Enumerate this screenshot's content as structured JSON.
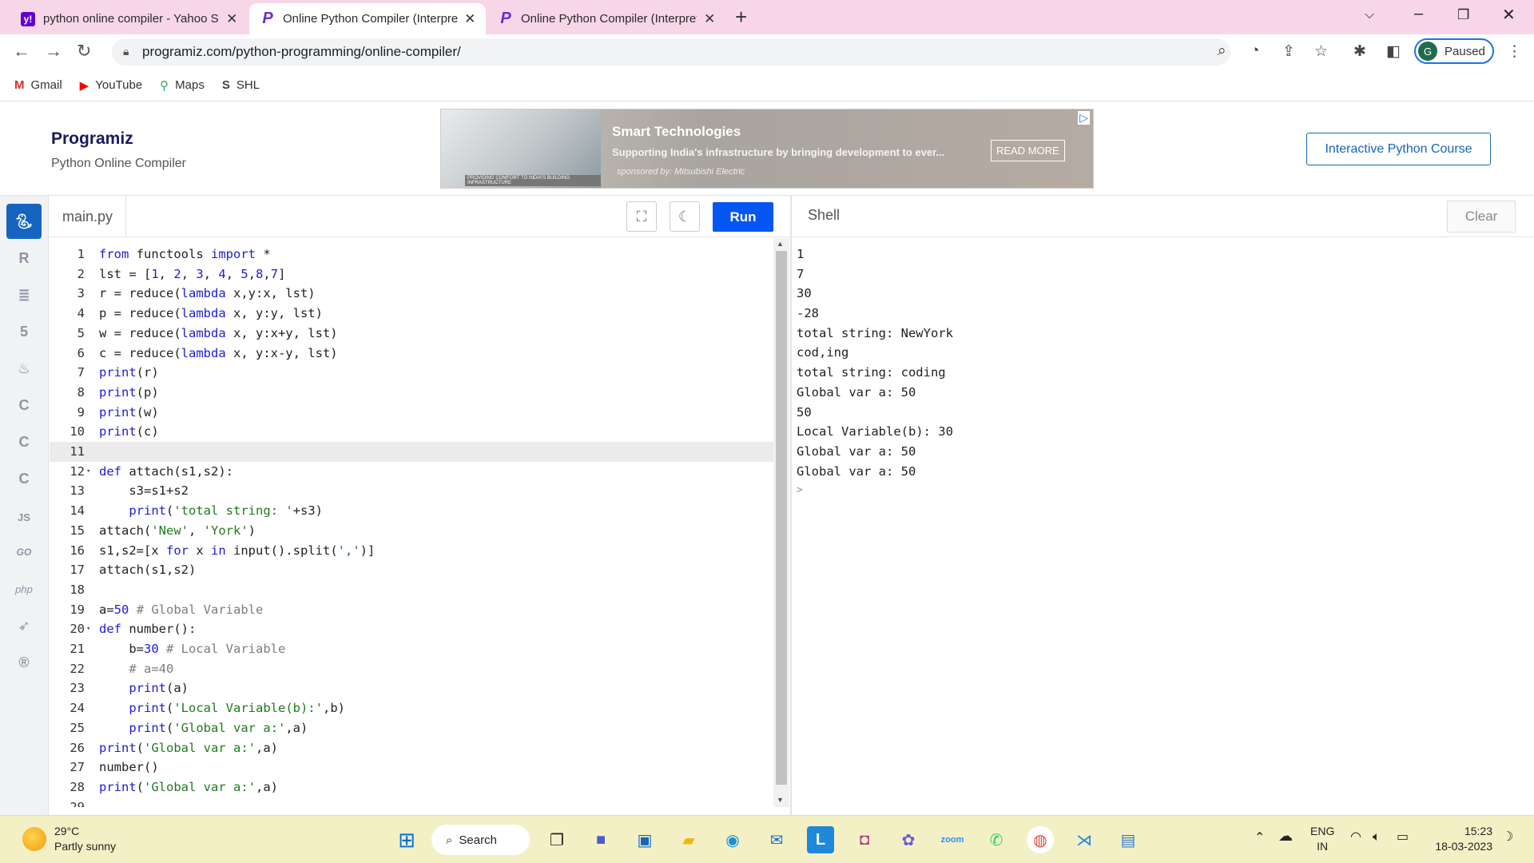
{
  "browser": {
    "tabs": [
      {
        "title": "python online compiler - Yahoo Search",
        "favicon": "yahoo-icon",
        "active": false
      },
      {
        "title": "Online Python Compiler (Interpreter)",
        "favicon": "programiz-icon",
        "active": true
      },
      {
        "title": "Online Python Compiler (Interpreter)",
        "favicon": "programiz-icon",
        "active": false
      }
    ],
    "url": "programiz.com/python-programming/online-compiler/",
    "profile_initial": "G",
    "profile_status": "Paused",
    "bookmarks": [
      {
        "label": "Gmail",
        "icon": "gmail-icon",
        "color": "#d93025"
      },
      {
        "label": "YouTube",
        "icon": "youtube-icon",
        "color": "#ff0000"
      },
      {
        "label": "Maps",
        "icon": "maps-icon",
        "color": "#34a853"
      },
      {
        "label": "SHL",
        "icon": "shl-icon",
        "color": "#444444"
      }
    ]
  },
  "header": {
    "logo": "Programiz",
    "subtitle": "Python Online Compiler",
    "ad": {
      "headline": "Smart Technologies",
      "text": "Supporting India's infrastructure by bringing development to ever...",
      "sponsor": "sponsored by: Mitsubishi Electric",
      "cta": "READ MORE",
      "photo_caption": "PROVIDING COMFORT TO INDIA'S BUILDING INFRASTRUCTURE"
    },
    "course_button": "Interactive Python Course"
  },
  "languages": [
    "python-icon",
    "r-icon",
    "sql-icon",
    "html-icon",
    "java-icon",
    "c-icon",
    "cpp-icon",
    "csharp-icon",
    "js-icon",
    "go-icon",
    "php-icon",
    "swift-icon",
    "rust-icon"
  ],
  "editor": {
    "file_tab": "main.py",
    "run_label": "Run",
    "current_line": 11,
    "lines": [
      {
        "n": "1",
        "code": "from functools import *"
      },
      {
        "n": "2",
        "code": "lst = [1, 2, 3, 4, 5,8,7]"
      },
      {
        "n": "3",
        "code": "r = reduce(lambda x,y:x, lst)"
      },
      {
        "n": "4",
        "code": "p = reduce(lambda x, y:y, lst)"
      },
      {
        "n": "5",
        "code": "w = reduce(lambda x, y:x+y, lst)"
      },
      {
        "n": "6",
        "code": "c = reduce(lambda x, y:x-y, lst)"
      },
      {
        "n": "7",
        "code": "print(r)"
      },
      {
        "n": "8",
        "code": "print(p)"
      },
      {
        "n": "9",
        "code": "print(w)"
      },
      {
        "n": "10",
        "code": "print(c)"
      },
      {
        "n": "11",
        "code": ""
      },
      {
        "n": "12",
        "code": "def attach(s1,s2):",
        "fold": true
      },
      {
        "n": "13",
        "code": "    s3=s1+s2"
      },
      {
        "n": "14",
        "code": "    print('total string: '+s3)"
      },
      {
        "n": "15",
        "code": "attach('New', 'York')"
      },
      {
        "n": "16",
        "code": "s1,s2=[x for x in input().split(',')]"
      },
      {
        "n": "17",
        "code": "attach(s1,s2)"
      },
      {
        "n": "18",
        "code": ""
      },
      {
        "n": "19",
        "code": "a=50 # Global Variable"
      },
      {
        "n": "20",
        "code": "def number():",
        "fold": true
      },
      {
        "n": "21",
        "code": "    b=30 # Local Variable"
      },
      {
        "n": "22",
        "code": "    # a=40"
      },
      {
        "n": "23",
        "code": "    print(a)"
      },
      {
        "n": "24",
        "code": "    print('Local Variable(b):',b)"
      },
      {
        "n": "25",
        "code": "    print('Global var a:',a)"
      },
      {
        "n": "26",
        "code": "print('Global var a:',a)"
      },
      {
        "n": "27",
        "code": "number()"
      },
      {
        "n": "28",
        "code": "print('Global var a:',a)"
      },
      {
        "n": "29",
        "code": ""
      }
    ]
  },
  "shell": {
    "title": "Shell",
    "clear_label": "Clear",
    "output": [
      "1",
      "7",
      "30",
      "-28",
      "total string: NewYork",
      "cod,ing",
      "total string: coding",
      "Global var a: 50",
      "50",
      "Local Variable(b): 30",
      "Global var a: 50",
      "Global var a: 50"
    ],
    "prompt": ">"
  },
  "taskbar": {
    "temperature": "29°C",
    "weather": "Partly sunny",
    "search_label": "Search",
    "apps": [
      "windows-start-icon",
      "task-view-icon",
      "teams-icon",
      "store-icon",
      "file-explorer-icon",
      "edge-icon",
      "mail-icon",
      "l-app-icon",
      "office-icon",
      "copilot-icon",
      "zoom-icon",
      "whatsapp-icon",
      "chrome-icon",
      "vscode-icon",
      "notepad-icon"
    ],
    "lang_top": "ENG",
    "lang_bottom": "IN",
    "time": "15:23",
    "date": "18-03-2023"
  }
}
